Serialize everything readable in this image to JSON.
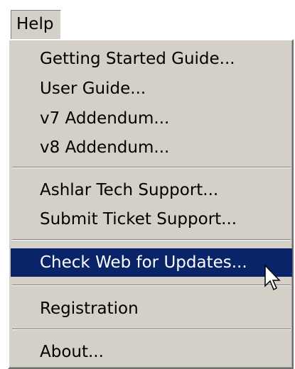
{
  "menu": {
    "title": "Help",
    "items": [
      {
        "label": "Getting Started Guide..."
      },
      {
        "label": "User Guide..."
      },
      {
        "label": "v7 Addendum..."
      },
      {
        "label": "v8 Addendum..."
      },
      {
        "label": "Ashlar Tech Support..."
      },
      {
        "label": "Submit Ticket Support..."
      },
      {
        "label": "Check Web for Updates..."
      },
      {
        "label": "Registration"
      },
      {
        "label": "About..."
      }
    ],
    "highlighted_item": "Check Web for Updates..."
  },
  "colors": {
    "menu_background": "#d4d0c8",
    "highlight_background": "#0a246a",
    "highlight_text": "#ffffff"
  },
  "cursor": {
    "icon": "arrow-pointer-icon"
  }
}
